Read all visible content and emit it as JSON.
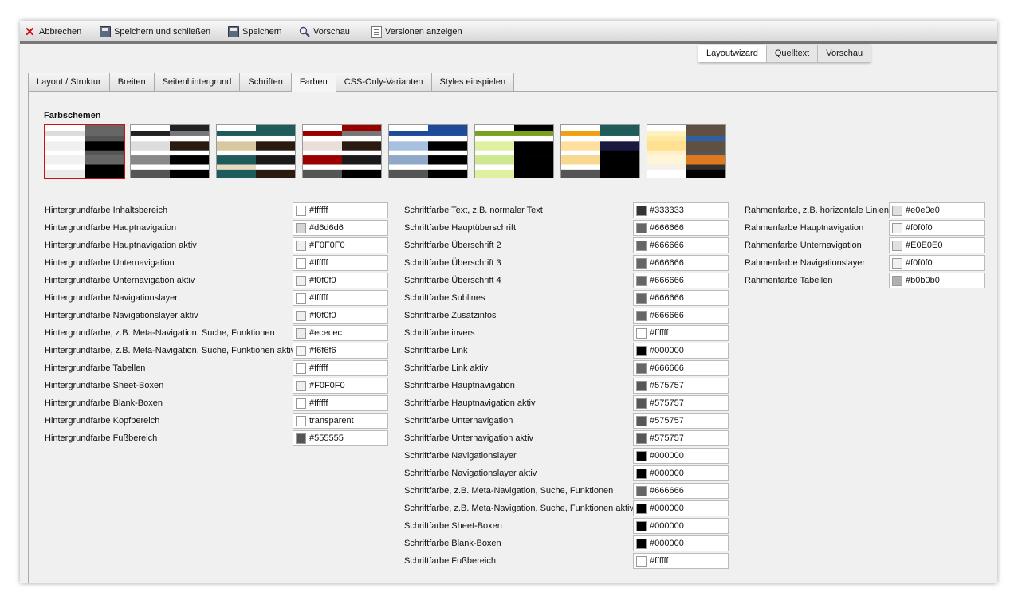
{
  "toolbar": {
    "cancel_label": "Abbrechen",
    "save_close_label": "Speichern und schließen",
    "save_label": "Speichern",
    "preview_label": "Vorschau",
    "versions_label": "Versionen anzeigen"
  },
  "mode_tabs": [
    "Layoutwizard",
    "Quelltext",
    "Vorschau"
  ],
  "mode_tab_active": 0,
  "tabs": [
    "Layout / Struktur",
    "Breiten",
    "Seitenhintergrund",
    "Schriften",
    "Farben",
    "CSS-Only-Varianten",
    "Styles einspielen"
  ],
  "tab_active": 4,
  "schemes_title": "Farbschemen",
  "schemes": [
    {
      "left": [
        "#ffffff",
        "#dcdcdc",
        "#ffffff",
        "#f0f0f0",
        "#ffffff",
        "#f0f0f0",
        "#ffffff",
        "#eaeaea"
      ],
      "right": [
        "#666666",
        "#666666",
        "#555555",
        "#000000",
        "#555555",
        "#666666",
        "#000000",
        "#000000"
      ]
    },
    {
      "left": [
        "#ffffff",
        "#222222",
        "#ffffff",
        "#dddddd",
        "#ffffff",
        "#888888",
        "#ffffff",
        "#555555"
      ],
      "right": [
        "#222222",
        "#777777",
        "#ffffff",
        "#2a1a10",
        "#ffffff",
        "#000000",
        "#ffffff",
        "#000000"
      ]
    },
    {
      "left": [
        "#ffffff",
        "#1e5c5c",
        "#ffffff",
        "#d8c8a0",
        "#ffffff",
        "#1e5c5c",
        "#e8dcc0",
        "#1e5c5c"
      ],
      "right": [
        "#1e5c5c",
        "#1e5c5c",
        "#ffffff",
        "#2a1a10",
        "#ffffff",
        "#1a1a1a",
        "#ffffff",
        "#2a1a10"
      ]
    },
    {
      "left": [
        "#ffffff",
        "#9a0000",
        "#ffffff",
        "#e8e0d8",
        "#ffffff",
        "#9a0000",
        "#ffffff",
        "#555555"
      ],
      "right": [
        "#9a0000",
        "#777777",
        "#ffffff",
        "#2a1a10",
        "#ffffff",
        "#1a1a1a",
        "#ffffff",
        "#000000"
      ]
    },
    {
      "left": [
        "#ffffff",
        "#1e4a9a",
        "#ffffff",
        "#a8c0e0",
        "#ffffff",
        "#8fa8c8",
        "#ffffff",
        "#555555"
      ],
      "right": [
        "#1e4a9a",
        "#1e4a9a",
        "#ffffff",
        "#000000",
        "#ffffff",
        "#000000",
        "#ffffff",
        "#000000"
      ]
    },
    {
      "left": [
        "#ffffff",
        "#7aa020",
        "#ffffff",
        "#dff0a0",
        "#ffffff",
        "#cce890",
        "#ffffff",
        "#dff0a0"
      ],
      "right": [
        "#000000",
        "#7aa020",
        "#ffffff",
        "#000000",
        "#000000",
        "#000000",
        "#000000",
        "#000000"
      ]
    },
    {
      "left": [
        "#ffffff",
        "#f0a010",
        "#ffffff",
        "#fde0a0",
        "#ffffff",
        "#f8d890",
        "#ffffff",
        "#555555"
      ],
      "right": [
        "#1e5c5c",
        "#1e5c5c",
        "#ffffff",
        "#1a1a40",
        "#000000",
        "#000000",
        "#000000",
        "#000000"
      ]
    },
    {
      "left": [
        "#ffffff",
        "#fff0c0",
        "#ffe8a0",
        "#ffe090",
        "#fff0c8",
        "#fff5d8",
        "#f5f0e8",
        "#ffffff"
      ],
      "right": [
        "#605040",
        "#605040",
        "#3060a0",
        "#605040",
        "#555555",
        "#e07820",
        "#303030",
        "#000000"
      ]
    }
  ],
  "columns": [
    [
      {
        "label": "Hintergrundfarbe Inhaltsbereich",
        "value": "#ffffff",
        "swatch": "#ffffff"
      },
      {
        "label": "Hintergrundfarbe Hauptnavigation",
        "value": "#d6d6d6",
        "swatch": "#d6d6d6"
      },
      {
        "label": "Hintergrundfarbe Hauptnavigation aktiv",
        "value": "#F0F0F0",
        "swatch": "#F0F0F0"
      },
      {
        "label": "Hintergrundfarbe Unternavigation",
        "value": "#ffffff",
        "swatch": "#ffffff"
      },
      {
        "label": "Hintergrundfarbe Unternavigation aktiv",
        "value": "#f0f0f0",
        "swatch": "#f0f0f0"
      },
      {
        "label": "Hintergrundfarbe Navigationslayer",
        "value": "#ffffff",
        "swatch": "#ffffff"
      },
      {
        "label": "Hintergrundfarbe Navigationslayer aktiv",
        "value": "#f0f0f0",
        "swatch": "#f0f0f0"
      },
      {
        "label": "Hintergrundfarbe, z.B. Meta-Navigation, Suche, Funktionen",
        "value": "#ececec",
        "swatch": "#ececec"
      },
      {
        "label": "Hintergrundfarbe, z.B. Meta-Navigation, Suche, Funktionen aktiv",
        "value": "#f6f6f6",
        "swatch": "#f6f6f6"
      },
      {
        "label": "Hintergrundfarbe Tabellen",
        "value": "#ffffff",
        "swatch": "#ffffff"
      },
      {
        "label": "Hintergrundfarbe Sheet-Boxen",
        "value": "#F0F0F0",
        "swatch": "#F0F0F0"
      },
      {
        "label": "Hintergrundfarbe Blank-Boxen",
        "value": "#ffffff",
        "swatch": "#ffffff"
      },
      {
        "label": "Hintergrundfarbe Kopfbereich",
        "value": "transparent",
        "swatch": "#ffffff"
      },
      {
        "label": "Hintergrundfarbe Fußbereich",
        "value": "#555555",
        "swatch": "#555555"
      }
    ],
    [
      {
        "label": "Schriftfarbe Text, z.B. normaler Text",
        "value": "#333333",
        "swatch": "#333333"
      },
      {
        "label": "Schriftfarbe Hauptüberschrift",
        "value": "#666666",
        "swatch": "#666666"
      },
      {
        "label": "Schriftfarbe Überschrift 2",
        "value": "#666666",
        "swatch": "#666666"
      },
      {
        "label": "Schriftfarbe Überschrift 3",
        "value": "#666666",
        "swatch": "#666666"
      },
      {
        "label": "Schriftfarbe Überschrift 4",
        "value": "#666666",
        "swatch": "#666666"
      },
      {
        "label": "Schriftfarbe Sublines",
        "value": "#666666",
        "swatch": "#666666"
      },
      {
        "label": "Schriftfarbe Zusatzinfos",
        "value": "#666666",
        "swatch": "#666666"
      },
      {
        "label": "Schriftfarbe invers",
        "value": "#ffffff",
        "swatch": "#ffffff"
      },
      {
        "label": "Schriftfarbe Link",
        "value": "#000000",
        "swatch": "#000000"
      },
      {
        "label": "Schriftfarbe Link aktiv",
        "value": "#666666",
        "swatch": "#666666"
      },
      {
        "label": "Schriftfarbe Hauptnavigation",
        "value": "#575757",
        "swatch": "#575757"
      },
      {
        "label": "Schriftfarbe Hauptnavigation aktiv",
        "value": "#575757",
        "swatch": "#575757"
      },
      {
        "label": "Schriftfarbe Unternavigation",
        "value": "#575757",
        "swatch": "#575757"
      },
      {
        "label": "Schriftfarbe Unternavigation aktiv",
        "value": "#575757",
        "swatch": "#575757"
      },
      {
        "label": "Schriftfarbe Navigationslayer",
        "value": "#000000",
        "swatch": "#000000"
      },
      {
        "label": "Schriftfarbe Navigationslayer aktiv",
        "value": "#000000",
        "swatch": "#000000"
      },
      {
        "label": "Schriftfarbe, z.B. Meta-Navigation, Suche, Funktionen",
        "value": "#666666",
        "swatch": "#666666"
      },
      {
        "label": "Schriftfarbe, z.B. Meta-Navigation, Suche, Funktionen aktiv",
        "value": "#000000",
        "swatch": "#000000"
      },
      {
        "label": "Schriftfarbe Sheet-Boxen",
        "value": "#000000",
        "swatch": "#000000"
      },
      {
        "label": "Schriftfarbe Blank-Boxen",
        "value": "#000000",
        "swatch": "#000000"
      },
      {
        "label": "Schriftfarbe Fußbereich",
        "value": "#ffffff",
        "swatch": "#ffffff"
      }
    ],
    [
      {
        "label": "Rahmenfarbe, z.B. horizontale Linien",
        "value": "#e0e0e0",
        "swatch": "#e0e0e0"
      },
      {
        "label": "Rahmenfarbe Hauptnavigation",
        "value": "#f0f0f0",
        "swatch": "#f0f0f0"
      },
      {
        "label": "Rahmenfarbe Unternavigation",
        "value": "#E0E0E0",
        "swatch": "#E0E0E0"
      },
      {
        "label": "Rahmenfarbe Navigationslayer",
        "value": "#f0f0f0",
        "swatch": "#f0f0f0"
      },
      {
        "label": "Rahmenfarbe Tabellen",
        "value": "#b0b0b0",
        "swatch": "#b0b0b0"
      }
    ]
  ]
}
